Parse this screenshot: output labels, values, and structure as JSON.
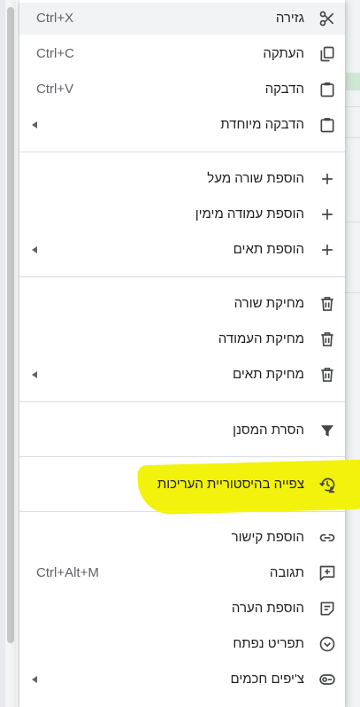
{
  "menu": {
    "items": [
      {
        "id": "cut",
        "label": "גזירה",
        "shortcut": "Ctrl+X",
        "icon": "scissors-icon",
        "submenu": false
      },
      {
        "id": "copy",
        "label": "העתקה",
        "shortcut": "Ctrl+C",
        "icon": "copy-icon",
        "submenu": false
      },
      {
        "id": "paste",
        "label": "הדבקה",
        "shortcut": "Ctrl+V",
        "icon": "clipboard-icon",
        "submenu": false
      },
      {
        "id": "paste-special",
        "label": "הדבקה מיוחדת",
        "shortcut": "",
        "icon": "clipboard-icon",
        "submenu": true
      },
      {
        "id": "insert-row-above",
        "label": "הוספת שורה מעל",
        "shortcut": "",
        "icon": "plus-icon",
        "submenu": false
      },
      {
        "id": "insert-column-right",
        "label": "הוספת עמודה מימין",
        "shortcut": "",
        "icon": "plus-icon",
        "submenu": false
      },
      {
        "id": "insert-cells",
        "label": "הוספת תאים",
        "shortcut": "",
        "icon": "plus-icon",
        "submenu": true
      },
      {
        "id": "delete-row",
        "label": "מחיקת שורה",
        "shortcut": "",
        "icon": "trash-icon",
        "submenu": false
      },
      {
        "id": "delete-column",
        "label": "מחיקת העמודה",
        "shortcut": "",
        "icon": "trash-icon",
        "submenu": false
      },
      {
        "id": "delete-cells",
        "label": "מחיקת תאים",
        "shortcut": "",
        "icon": "trash-icon",
        "submenu": true
      },
      {
        "id": "remove-filter",
        "label": "הסרת המסנן",
        "shortcut": "",
        "icon": "filter-icon",
        "submenu": false
      },
      {
        "id": "edit-history",
        "label": "צפייה בהיסטוריית העריכות",
        "shortcut": "",
        "icon": "edit-history-icon",
        "submenu": false
      },
      {
        "id": "insert-link",
        "label": "הוספת קישור",
        "shortcut": "",
        "icon": "link-icon",
        "submenu": false
      },
      {
        "id": "comment",
        "label": "תגובה",
        "shortcut": "Ctrl+Alt+M",
        "icon": "add-comment-icon",
        "submenu": false
      },
      {
        "id": "insert-note",
        "label": "הוספת הערה",
        "shortcut": "",
        "icon": "note-icon",
        "submenu": false
      },
      {
        "id": "dropdown",
        "label": "תפריט נפתח",
        "shortcut": "",
        "icon": "dropdown-icon",
        "submenu": false
      },
      {
        "id": "smart-chips",
        "label": "צ'יפים חכמים",
        "shortcut": "",
        "icon": "smart-chip-icon",
        "submenu": true
      }
    ]
  },
  "colors": {
    "highlight": "#f2f20c",
    "hover": "#f1f3f4",
    "separator": "#dadce0",
    "text": "#202124",
    "muted": "#5f6368"
  }
}
